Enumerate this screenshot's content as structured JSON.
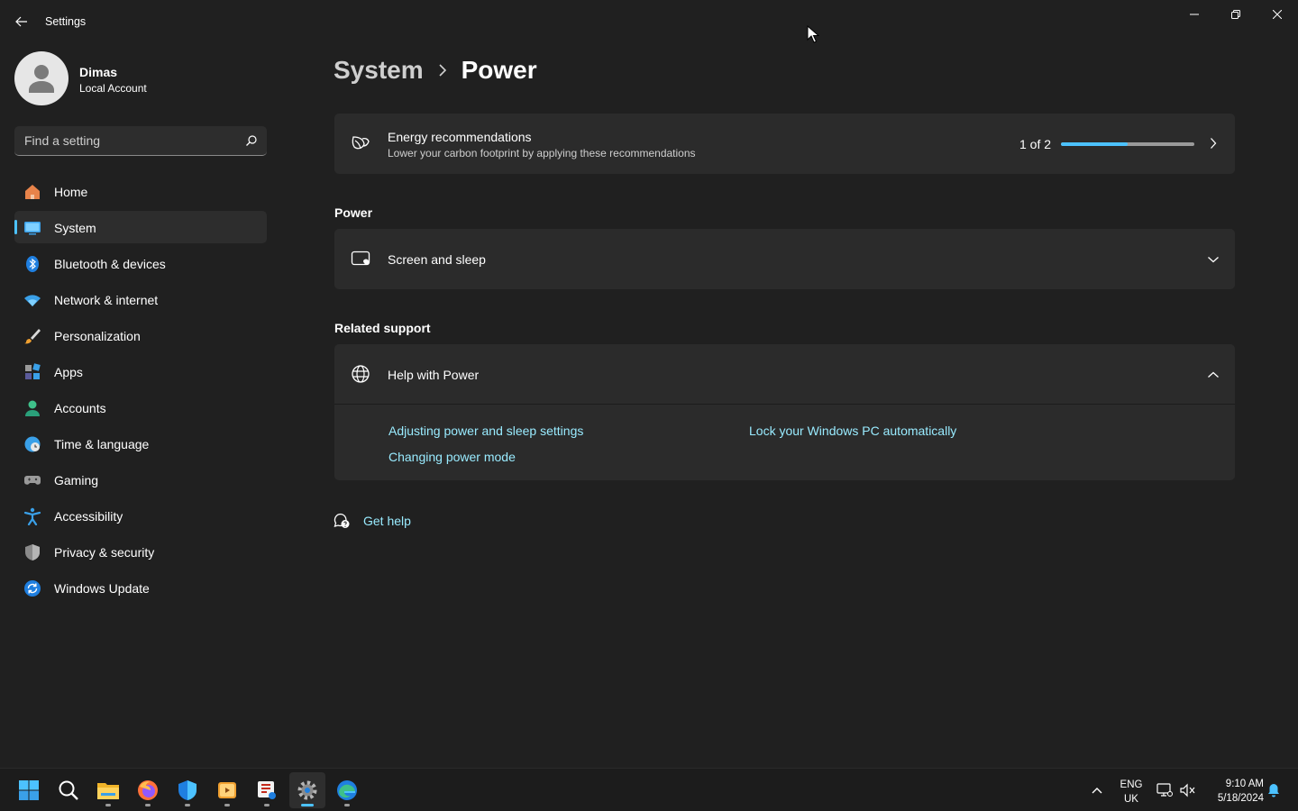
{
  "window": {
    "title": "Settings"
  },
  "profile": {
    "name": "Dimas",
    "account_type": "Local Account"
  },
  "search": {
    "placeholder": "Find a setting"
  },
  "sidebar": {
    "items": [
      {
        "label": "Home",
        "icon": "home-icon",
        "active": false
      },
      {
        "label": "System",
        "icon": "system-icon",
        "active": true
      },
      {
        "label": "Bluetooth & devices",
        "icon": "bluetooth-icon",
        "active": false
      },
      {
        "label": "Network & internet",
        "icon": "wifi-icon",
        "active": false
      },
      {
        "label": "Personalization",
        "icon": "brush-icon",
        "active": false
      },
      {
        "label": "Apps",
        "icon": "apps-icon",
        "active": false
      },
      {
        "label": "Accounts",
        "icon": "accounts-icon",
        "active": false
      },
      {
        "label": "Time & language",
        "icon": "globe-clock-icon",
        "active": false
      },
      {
        "label": "Gaming",
        "icon": "gamepad-icon",
        "active": false
      },
      {
        "label": "Accessibility",
        "icon": "accessibility-icon",
        "active": false
      },
      {
        "label": "Privacy & security",
        "icon": "shield-icon",
        "active": false
      },
      {
        "label": "Windows Update",
        "icon": "update-icon",
        "active": false
      }
    ]
  },
  "breadcrumb": {
    "parent": "System",
    "current": "Power"
  },
  "energy": {
    "title": "Energy recommendations",
    "description": "Lower your carbon footprint by applying these recommendations",
    "progress_text": "1 of 2",
    "progress_fraction": 0.5
  },
  "sections": {
    "power_title": "Power",
    "related_title": "Related support"
  },
  "screen_sleep": {
    "label": "Screen and sleep"
  },
  "help": {
    "title": "Help with Power",
    "links": [
      "Adjusting power and sleep settings",
      "Lock your Windows PC automatically",
      "Changing power mode"
    ]
  },
  "get_help": {
    "label": "Get help"
  },
  "taskbar": {
    "apps": [
      "start-icon",
      "search-icon",
      "file-explorer-icon",
      "firefox-icon",
      "defender-icon",
      "media-player-icon",
      "snipping-tool-icon",
      "settings-icon",
      "edge-icon"
    ],
    "active_app": "settings-icon",
    "language": {
      "line1": "ENG",
      "line2": "UK"
    },
    "time": "9:10 AM",
    "date": "5/18/2024"
  },
  "colors": {
    "accent": "#4cc2ff",
    "link": "#99ebff",
    "background": "#202020",
    "card": "#2b2b2b"
  }
}
